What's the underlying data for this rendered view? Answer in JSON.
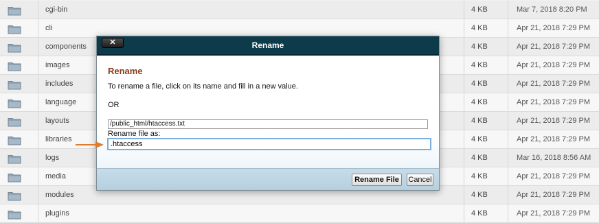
{
  "files": [
    {
      "name": "cgi-bin",
      "size": "4 KB",
      "date": "Mar 7, 2018 8:20 PM"
    },
    {
      "name": "cli",
      "size": "4 KB",
      "date": "Apr 21, 2018 7:29 PM"
    },
    {
      "name": "components",
      "size": "4 KB",
      "date": "Apr 21, 2018 7:29 PM"
    },
    {
      "name": "images",
      "size": "4 KB",
      "date": "Apr 21, 2018 7:29 PM"
    },
    {
      "name": "includes",
      "size": "4 KB",
      "date": "Apr 21, 2018 7:29 PM"
    },
    {
      "name": "language",
      "size": "4 KB",
      "date": "Apr 21, 2018 7:29 PM"
    },
    {
      "name": "layouts",
      "size": "4 KB",
      "date": "Apr 21, 2018 7:29 PM"
    },
    {
      "name": "libraries",
      "size": "4 KB",
      "date": "Apr 21, 2018 7:29 PM"
    },
    {
      "name": "logs",
      "size": "4 KB",
      "date": "Mar 16, 2018 8:56 AM"
    },
    {
      "name": "media",
      "size": "4 KB",
      "date": "Apr 21, 2018 7:29 PM"
    },
    {
      "name": "modules",
      "size": "4 KB",
      "date": "Apr 21, 2018 7:29 PM"
    },
    {
      "name": "plugins",
      "size": "4 KB",
      "date": "Apr 21, 2018 7:29 PM"
    }
  ],
  "dialog": {
    "title": "Rename",
    "close_label": "✕",
    "heading": "Rename",
    "instruction": "To rename a file, click on its name and fill in a new value.",
    "or_text": "OR",
    "current_path": "/public_html/htaccess.txt",
    "rename_label": "Rename file as:",
    "new_name_value": ".htaccess",
    "rename_button_label": "Rename File",
    "cancel_button_label": "Cancel"
  },
  "icons": {
    "row_icon": "folder-icon",
    "close_icon": "close-icon",
    "annotation": "arrow-right-icon"
  },
  "colors": {
    "titlebar": "#0d3b4a",
    "heading": "#8b3a1a",
    "arrow": "#e07b2c",
    "input_focus": "#7aaee0",
    "folder": "#8fa3b3"
  }
}
